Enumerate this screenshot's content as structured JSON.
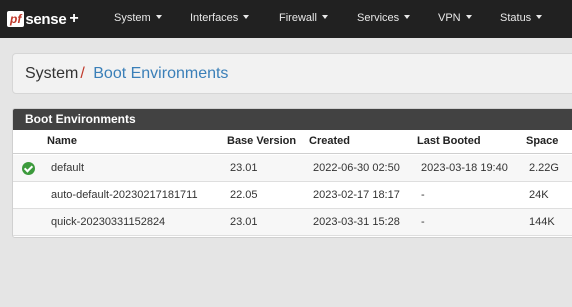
{
  "brand": {
    "pf": "pf",
    "rest": "sense",
    "plus": "+"
  },
  "nav": [
    {
      "label": "System"
    },
    {
      "label": "Interfaces"
    },
    {
      "label": "Firewall"
    },
    {
      "label": "Services"
    },
    {
      "label": "VPN"
    },
    {
      "label": "Status"
    }
  ],
  "breadcrumb": {
    "parent": "System",
    "separator": "/",
    "current": "Boot Environments"
  },
  "panel": {
    "title": "Boot Environments",
    "columns": [
      "Name",
      "Base Version",
      "Created",
      "Last Booted",
      "Space"
    ],
    "rows": [
      {
        "active": true,
        "name": "default",
        "base_version": "23.01",
        "created": "2022-06-30 02:50",
        "last_booted": "2023-03-18 19:40",
        "space": "2.22G"
      },
      {
        "active": false,
        "name": "auto-default-20230217181711",
        "base_version": "22.05",
        "created": "2023-02-17 18:17",
        "last_booted": "-",
        "space": "24K"
      },
      {
        "active": false,
        "name": "quick-20230331152824",
        "base_version": "23.01",
        "created": "2023-03-31 15:28",
        "last_booted": "-",
        "space": "144K"
      }
    ]
  },
  "colors": {
    "navbar": "#212121",
    "panel_header": "#424242",
    "breadcrumb_current": "#3a7fb8",
    "active_check": "#3c9a3c"
  }
}
